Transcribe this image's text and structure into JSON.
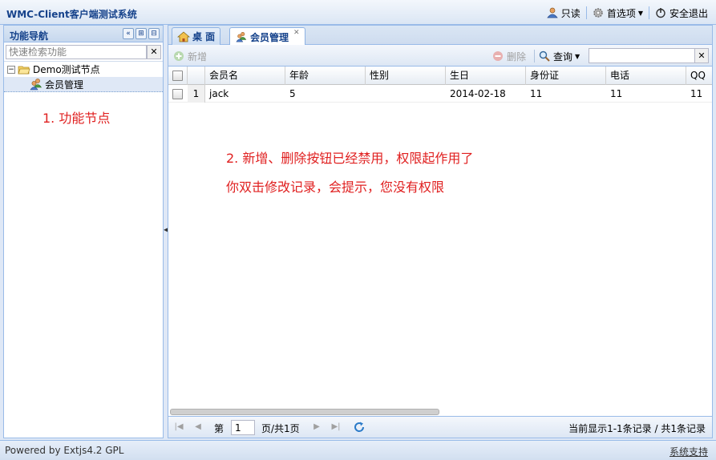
{
  "app": {
    "title": "WMC-Client客户端测试系统"
  },
  "top_actions": {
    "readonly": "只读",
    "preferences": "首选项",
    "logout": "安全退出"
  },
  "nav": {
    "title": "功能导航",
    "search_placeholder": "快速检索功能",
    "tree": [
      {
        "label": "Demo测试节点"
      },
      {
        "label": "会员管理"
      }
    ]
  },
  "annotations": {
    "note1": "1. 功能节点",
    "note2_line1": "2. 新增、删除按钮已经禁用，权限起作用了",
    "note2_line2": "你双击修改记录，会提示，您没有权限"
  },
  "tabs": [
    {
      "label": "桌 面"
    },
    {
      "label": "会员管理"
    }
  ],
  "toolbar": {
    "add": "新增",
    "delete": "删除",
    "query": "查询"
  },
  "grid": {
    "columns": [
      "会员名",
      "年龄",
      "性别",
      "生日",
      "身份证",
      "电话",
      "QQ"
    ],
    "rows": [
      {
        "rownum": "1",
        "name": "jack",
        "age": "5",
        "gender": "",
        "birthday": "2014-02-18",
        "idcard": "11",
        "phone": "11",
        "qq": "11"
      }
    ]
  },
  "pager": {
    "page_prefix": "第",
    "page_value": "1",
    "page_suffix": "页/共1页",
    "status": "当前显示1-1条记录 / 共1条记录"
  },
  "footer": {
    "powered_by": "Powered by Extjs4.2 GPL",
    "support": "系统支持"
  },
  "colors": {
    "accent": "#15428b",
    "border": "#99bbe8",
    "annotation": "#e02020"
  }
}
